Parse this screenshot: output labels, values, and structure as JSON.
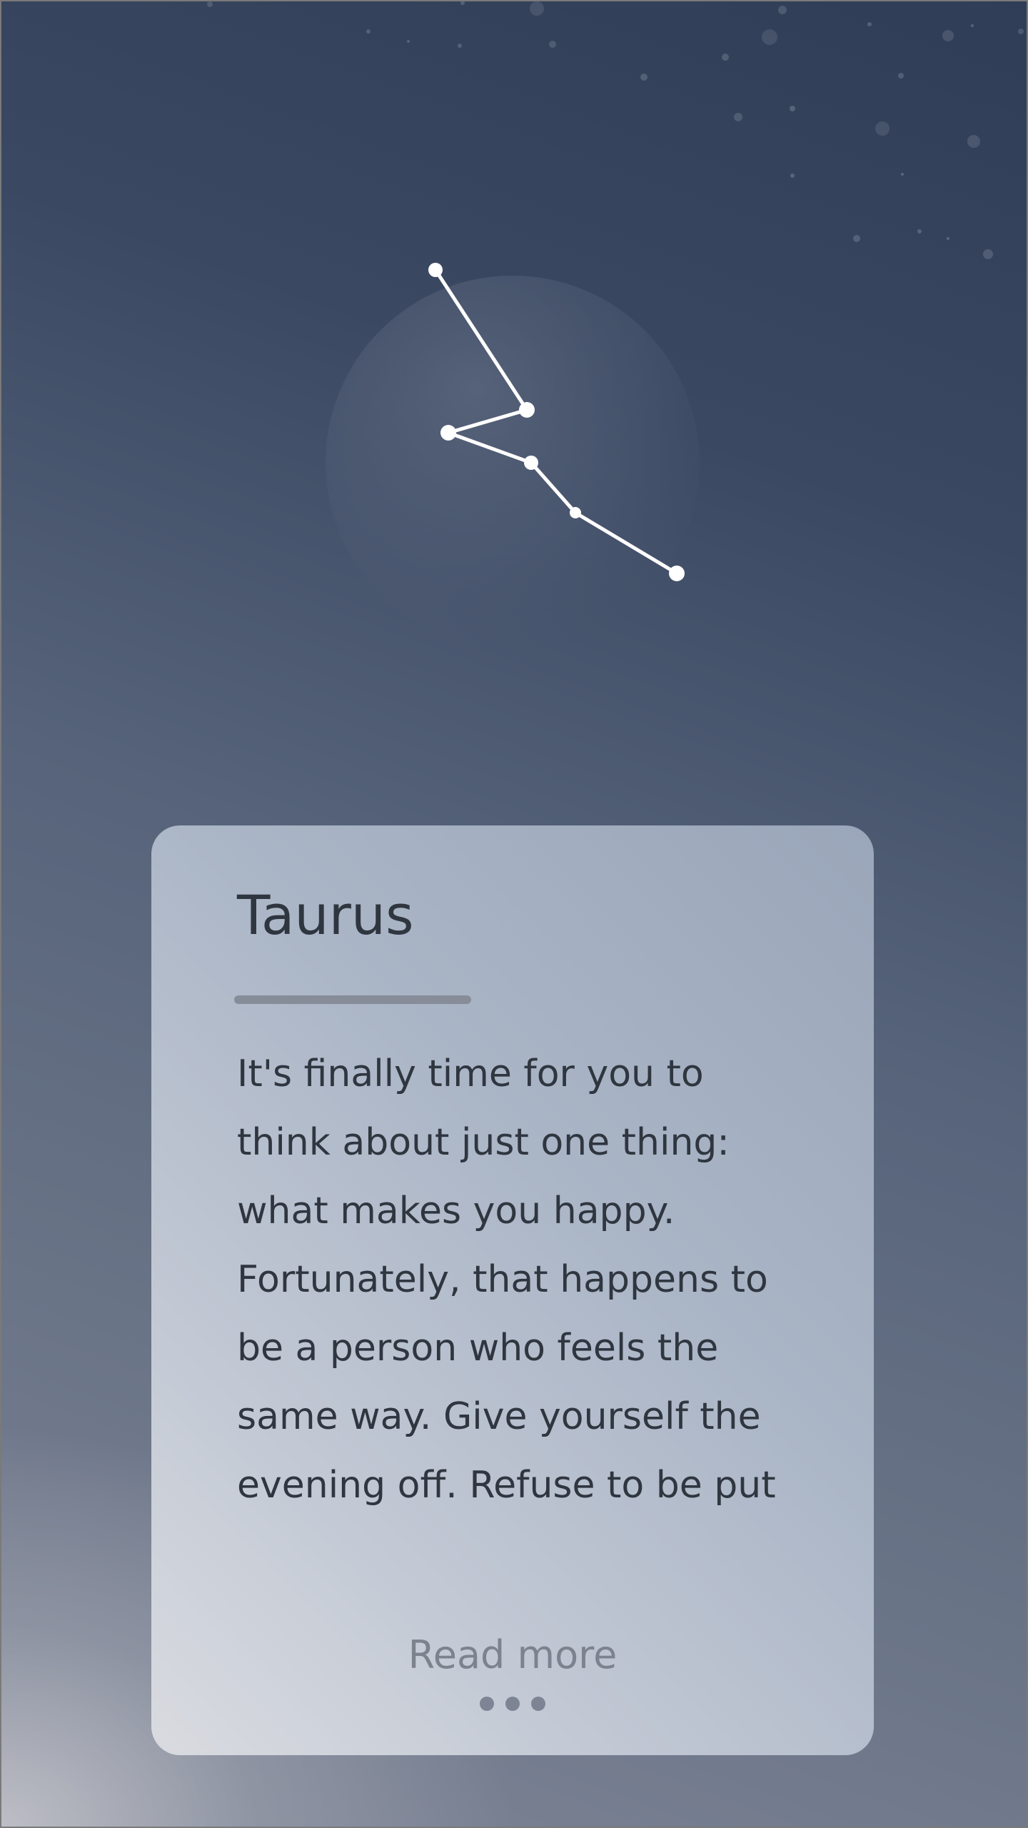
{
  "card": {
    "title": "Taurus",
    "body": "It's finally time for you to think about just one thing: what makes you happy. Fortunately, that happens to be a person who feels the same way. Give yourself the evening off. Refuse to be put",
    "read_more_label": "Read more",
    "pagination_dots": 3
  },
  "colors": {
    "star": "#ffffff",
    "card_text": "#2f3640",
    "read_more": "#7d838e",
    "divider": "#868d99"
  },
  "icons": {
    "constellation": "taurus-constellation-icon",
    "more": "ellipsis-icon"
  }
}
